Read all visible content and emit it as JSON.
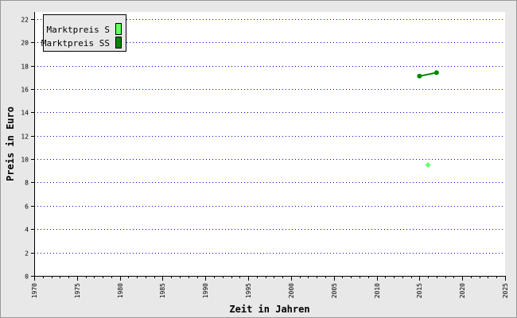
{
  "chart_data": {
    "type": "line",
    "xlabel": "Zeit in Jahren",
    "ylabel": "Preis in Euro",
    "xlim": [
      1970,
      2025
    ],
    "ylim": [
      0,
      22.6
    ],
    "x_ticks": [
      1970,
      1975,
      1980,
      1985,
      1990,
      1995,
      2000,
      2005,
      2010,
      2015,
      2020,
      2025
    ],
    "y_ticks": [
      0,
      2,
      4,
      6,
      8,
      10,
      12,
      14,
      16,
      18,
      20,
      22
    ],
    "grid": "horizontal dotted",
    "legend_position": "top-left",
    "series": [
      {
        "name": "Marktpreis S",
        "color": "#66ff66",
        "marker": "diamond",
        "points": [
          {
            "x": 2016,
            "y": 9.5
          }
        ]
      },
      {
        "name": "Marktpreis SS",
        "color": "#008800",
        "marker": "circle",
        "points": [
          {
            "x": 2015,
            "y": 17.1
          },
          {
            "x": 2017,
            "y": 17.4
          }
        ]
      }
    ]
  },
  "colors": {
    "frame_background": "#e8e8e8",
    "plot_background": "#ffffff",
    "grid": "#0000cc",
    "axis": "#000000"
  }
}
